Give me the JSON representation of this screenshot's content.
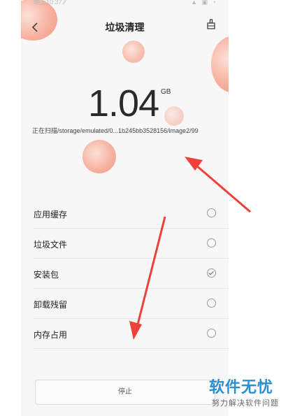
{
  "status_bar": {
    "time": "晚上10:37 ⁄⁄",
    "icons": "▲ ▣ ◔"
  },
  "header": {
    "title": "垃圾清理",
    "back_icon": "chevron-left-icon",
    "action_icon": "broom-icon"
  },
  "scan": {
    "size_value": "1.04",
    "size_unit": "GB",
    "path": "正在扫描/storage/emulated/0...1b245bb3528156/image2/99"
  },
  "categories": [
    {
      "label": "应用缓存",
      "checked": false
    },
    {
      "label": "垃圾文件",
      "checked": false
    },
    {
      "label": "安装包",
      "checked": true
    },
    {
      "label": "卸载残留",
      "checked": false
    },
    {
      "label": "内存占用",
      "checked": false
    }
  ],
  "footer": {
    "stop_label": "停止"
  },
  "watermark": {
    "main": "软件无忧",
    "sub": "努力解决软件问题"
  },
  "colors": {
    "bubble": "#f29a87",
    "arrow": "#f0403a",
    "watermark": "#2a8fd3"
  }
}
